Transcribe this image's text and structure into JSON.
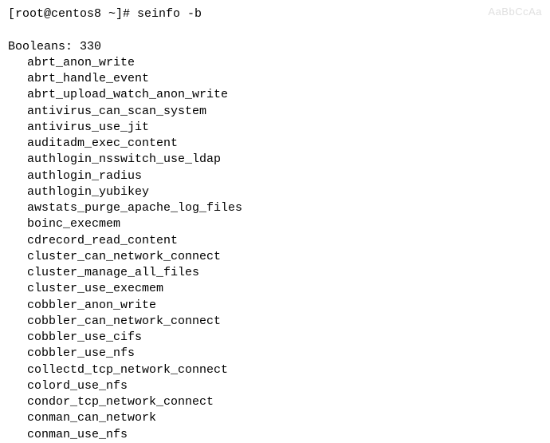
{
  "prompt": "[root@centos8 ~]# ",
  "command": "seinfo -b",
  "header_label": "Booleans:",
  "header_count": "330",
  "booleans": [
    "abrt_anon_write",
    "abrt_handle_event",
    "abrt_upload_watch_anon_write",
    "antivirus_can_scan_system",
    "antivirus_use_jit",
    "auditadm_exec_content",
    "authlogin_nsswitch_use_ldap",
    "authlogin_radius",
    "authlogin_yubikey",
    "awstats_purge_apache_log_files",
    "boinc_execmem",
    "cdrecord_read_content",
    "cluster_can_network_connect",
    "cluster_manage_all_files",
    "cluster_use_execmem",
    "cobbler_anon_write",
    "cobbler_can_network_connect",
    "cobbler_use_cifs",
    "cobbler_use_nfs",
    "collectd_tcp_network_connect",
    "colord_use_nfs",
    "condor_tcp_network_connect",
    "conman_can_network",
    "conman_use_nfs"
  ],
  "faded_text": "AaBbCcAa"
}
